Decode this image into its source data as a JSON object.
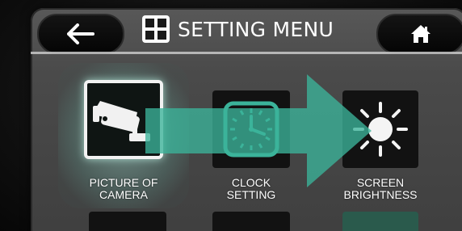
{
  "header": {
    "title": "SETTING MENU",
    "back_icon": "arrow-left-icon",
    "menu_icon": "grid-icon",
    "home_icon": "home-icon"
  },
  "menu_items": [
    {
      "label_line1": "PICTURE OF",
      "label_line2": "CAMERA",
      "icon": "security-camera-icon",
      "selected": true
    },
    {
      "label_line1": "CLOCK",
      "label_line2": "SETTING",
      "icon": "clock-icon",
      "selected": false
    },
    {
      "label_line1": "SCREEN",
      "label_line2": "BRIGHTNESS",
      "icon": "sun-icon",
      "selected": false
    }
  ],
  "colors": {
    "accent_teal": "#3bb39a",
    "background_panel": "#4a4a4a",
    "button_black": "#0a0a0a"
  }
}
